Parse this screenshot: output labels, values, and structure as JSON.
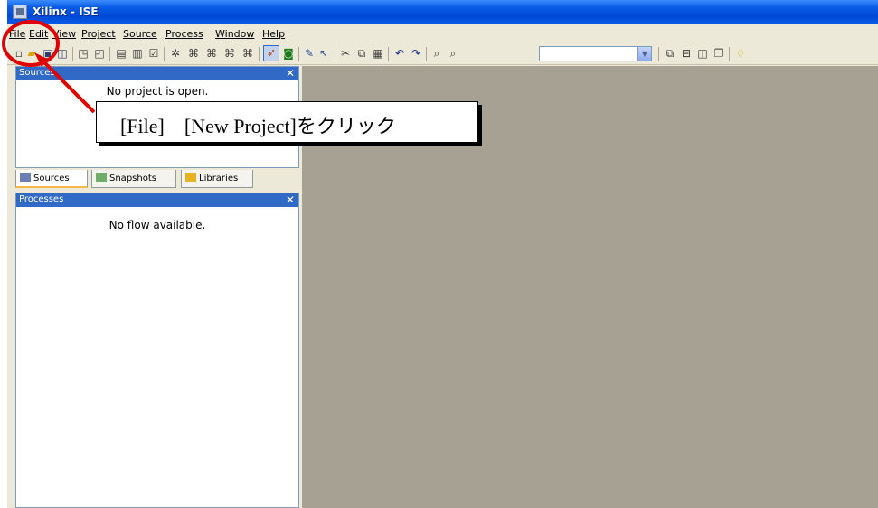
{
  "window": {
    "title": "Xilinx - ISE"
  },
  "menubar": {
    "items": [
      "File",
      "Edit",
      "View",
      "Project",
      "Source",
      "Process",
      "Window",
      "Help"
    ]
  },
  "toolbar": {
    "icons": [
      "new-icon",
      "open-icon",
      "save-icon",
      "save-all-icon",
      "print-preview-icon",
      "print-icon",
      "edit-icon",
      "design-summary-icon",
      "checkbox-icon",
      "implement-icon",
      "synthesize-icon",
      "translate-icon",
      "map-icon",
      "place-route-icon",
      "wizard-icon",
      "refresh-icon",
      "pen-icon",
      "help-cursor-icon",
      "cut-icon",
      "copy-icon",
      "paste-icon",
      "undo-icon",
      "redo-icon",
      "find-icon",
      "find-in-files-icon",
      "combo-dropdown",
      "cascade-icon",
      "tile-horizontal-icon",
      "tile-vertical-icon",
      "restore-icon",
      "lightbulb-icon"
    ],
    "search_value": ""
  },
  "sources_panel": {
    "header": "Sources",
    "message": "No project is open."
  },
  "tabs": [
    {
      "label": "Sources",
      "active": true
    },
    {
      "label": "Snapshots",
      "active": false
    },
    {
      "label": "Libraries",
      "active": false
    }
  ],
  "processes_panel": {
    "header": "Processes",
    "message": "No flow available."
  },
  "annotation": {
    "text": "[File]　[New Project]をクリック",
    "color": "#e00000"
  }
}
